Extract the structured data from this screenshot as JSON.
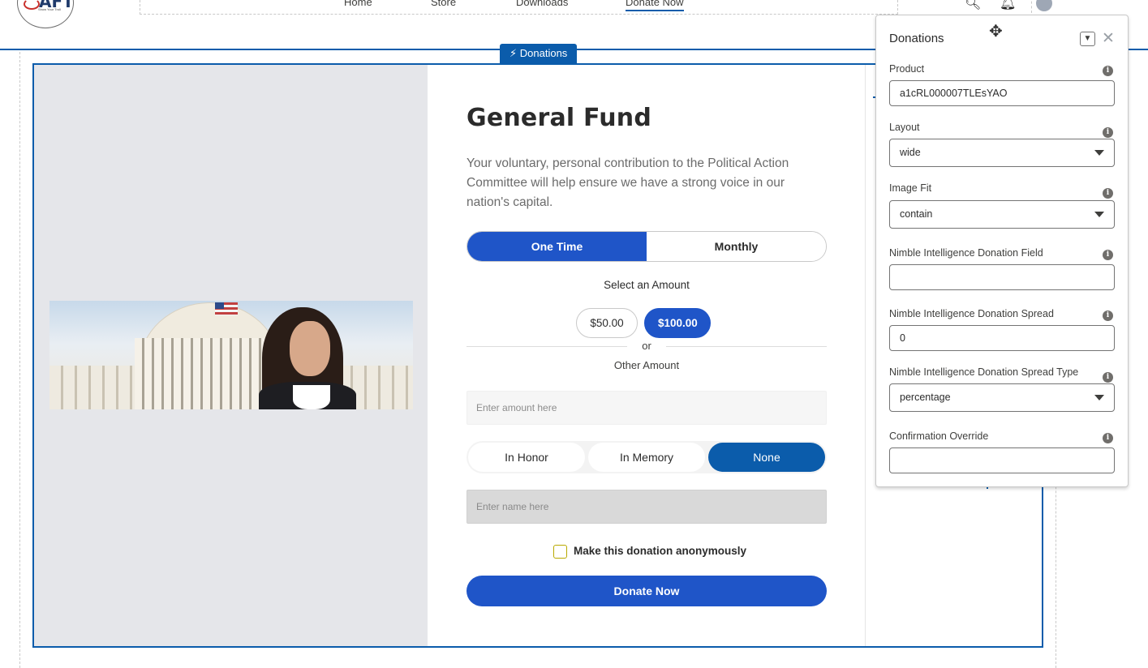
{
  "header": {
    "logo_text": "AFT",
    "logo_subtext": "Show Your Troll",
    "nav": [
      {
        "label": "Home"
      },
      {
        "label": "Store"
      },
      {
        "label": "Downloads"
      },
      {
        "label": "Donate Now",
        "active": true
      }
    ],
    "icons": [
      "search-icon",
      "bell-icon",
      "user-avatar"
    ]
  },
  "component": {
    "label": "Donations",
    "label_icon": "lightning-icon"
  },
  "donation_form": {
    "title": "General Fund",
    "description": "Your voluntary, personal contribution to the Political Action Committee will help ensure we have a strong voice in our nation's capital.",
    "frequency": {
      "options": [
        "One Time",
        "Monthly"
      ],
      "selected": "One Time"
    },
    "select_amount_label": "Select an Amount",
    "amounts": [
      {
        "label": "$50.00",
        "selected": false
      },
      {
        "label": "$100.00",
        "selected": true
      }
    ],
    "or_label": "or",
    "other_amount_label": "Other Amount",
    "amount_placeholder": "Enter amount here",
    "tribute": {
      "options": [
        "In Honor",
        "In Memory",
        "None"
      ],
      "selected": "None"
    },
    "name_placeholder": "Enter name here",
    "anonymous_label": "Make this donation anonymously",
    "anonymous_checked": false,
    "donate_button": "Donate Now"
  },
  "properties_panel": {
    "title": "Donations",
    "fields": [
      {
        "label": "Product",
        "type": "text",
        "value": "a1cRL000007TLEsYAO"
      },
      {
        "label": "Layout",
        "type": "select",
        "value": "wide"
      },
      {
        "label": "Image Fit",
        "type": "select",
        "value": "contain"
      },
      {
        "label": "Nimble Intelligence Donation Field",
        "type": "text",
        "value": ""
      },
      {
        "label": "Nimble Intelligence Donation Spread",
        "type": "text",
        "value": "0"
      },
      {
        "label": "Nimble Intelligence Donation Spread Type",
        "type": "select",
        "value": "percentage"
      },
      {
        "label": "Confirmation Override",
        "type": "text",
        "value": ""
      }
    ]
  },
  "colors": {
    "accent": "#0b5cab",
    "button_blue": "#1f55c8",
    "image_bg": "#e5e6ea",
    "checkbox_border": "#b8a900"
  }
}
